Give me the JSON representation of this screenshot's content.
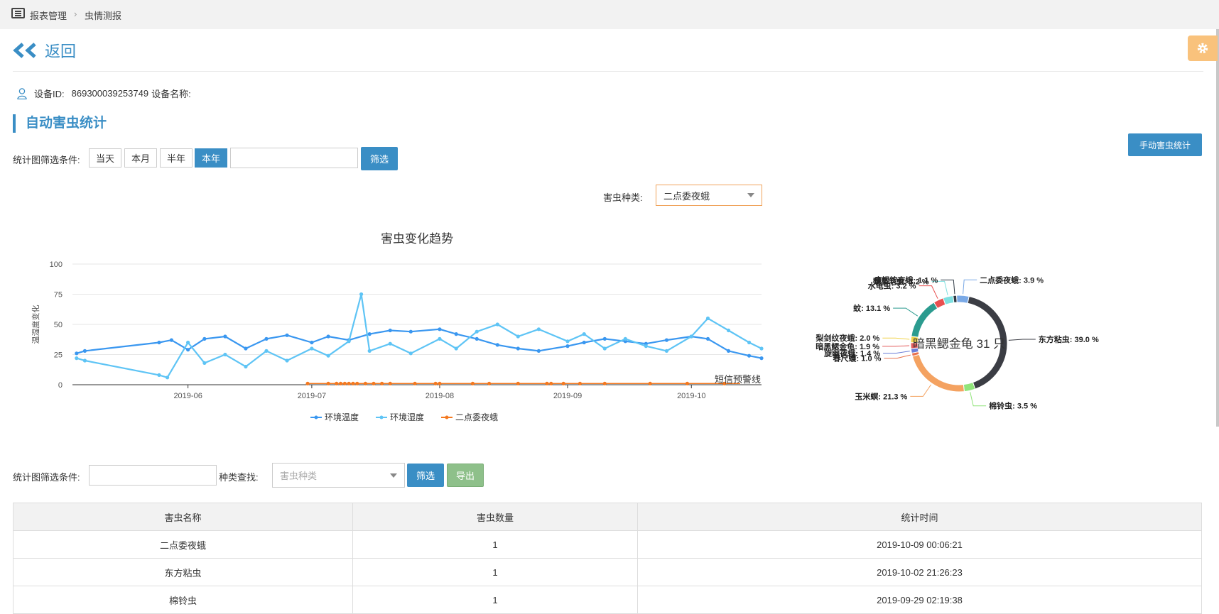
{
  "breadcrumb": {
    "parent": "报表管理",
    "separator": "›",
    "current": "虫情测报"
  },
  "header": {
    "back_label": "返回"
  },
  "device": {
    "id_label": "设备ID:",
    "id_value": "869300039253749",
    "name_label": "设备名称:"
  },
  "section": {
    "title": "自动害虫统计",
    "manual_button": "手动害虫统计"
  },
  "top_filter": {
    "label": "统计图筛选条件:",
    "ranges": [
      {
        "label": "当天",
        "active": false
      },
      {
        "label": "本月",
        "active": false
      },
      {
        "label": "半年",
        "active": false
      },
      {
        "label": "本年",
        "active": true
      }
    ],
    "date_value": "",
    "submit_label": "筛选"
  },
  "pest_type": {
    "label": "害虫种类:",
    "selected": "二点委夜蛾"
  },
  "chart_data": [
    {
      "type": "line",
      "title": "害虫变化趋势",
      "ylabel": "温湿度变化",
      "xlabel": "",
      "ylim": [
        0,
        100
      ],
      "yticks": [
        0,
        25,
        50,
        75,
        100
      ],
      "x_range": [
        "2019-05-04",
        "2019-10-18"
      ],
      "xticks": [
        "2019-06",
        "2019-07",
        "2019-08",
        "2019-09",
        "2019-10"
      ],
      "grid": true,
      "legend_position": "bottom",
      "series": [
        {
          "name": "环境温度",
          "color": "#3a97f0",
          "points": [
            [
              "2019-05-05",
              26
            ],
            [
              "2019-05-07",
              28
            ],
            [
              "2019-05-25",
              35
            ],
            [
              "2019-05-28",
              37
            ],
            [
              "2019-06-01",
              29
            ],
            [
              "2019-06-05",
              38
            ],
            [
              "2019-06-10",
              40
            ],
            [
              "2019-06-15",
              30
            ],
            [
              "2019-06-20",
              38
            ],
            [
              "2019-06-25",
              41
            ],
            [
              "2019-07-01",
              35
            ],
            [
              "2019-07-05",
              40
            ],
            [
              "2019-07-10",
              37
            ],
            [
              "2019-07-15",
              42
            ],
            [
              "2019-07-20",
              45
            ],
            [
              "2019-07-25",
              44
            ],
            [
              "2019-08-01",
              46
            ],
            [
              "2019-08-05",
              42
            ],
            [
              "2019-08-10",
              38
            ],
            [
              "2019-08-15",
              33
            ],
            [
              "2019-08-20",
              30
            ],
            [
              "2019-08-25",
              28
            ],
            [
              "2019-09-01",
              32
            ],
            [
              "2019-09-05",
              35
            ],
            [
              "2019-09-10",
              38
            ],
            [
              "2019-09-15",
              36
            ],
            [
              "2019-09-20",
              34
            ],
            [
              "2019-09-25",
              37
            ],
            [
              "2019-10-01",
              40
            ],
            [
              "2019-10-05",
              38
            ],
            [
              "2019-10-10",
              28
            ],
            [
              "2019-10-15",
              24
            ],
            [
              "2019-10-18",
              22
            ]
          ]
        },
        {
          "name": "环境湿度",
          "color": "#5ec4f5",
          "points": [
            [
              "2019-05-05",
              22
            ],
            [
              "2019-05-07",
              20
            ],
            [
              "2019-05-25",
              8
            ],
            [
              "2019-05-27",
              6
            ],
            [
              "2019-06-01",
              35
            ],
            [
              "2019-06-05",
              18
            ],
            [
              "2019-06-10",
              25
            ],
            [
              "2019-06-15",
              15
            ],
            [
              "2019-06-20",
              28
            ],
            [
              "2019-06-25",
              20
            ],
            [
              "2019-07-01",
              30
            ],
            [
              "2019-07-05",
              24
            ],
            [
              "2019-07-10",
              36
            ],
            [
              "2019-07-13",
              75
            ],
            [
              "2019-07-15",
              28
            ],
            [
              "2019-07-20",
              34
            ],
            [
              "2019-07-25",
              26
            ],
            [
              "2019-08-01",
              38
            ],
            [
              "2019-08-05",
              30
            ],
            [
              "2019-08-10",
              44
            ],
            [
              "2019-08-15",
              50
            ],
            [
              "2019-08-20",
              40
            ],
            [
              "2019-08-25",
              46
            ],
            [
              "2019-09-01",
              36
            ],
            [
              "2019-09-05",
              42
            ],
            [
              "2019-09-10",
              30
            ],
            [
              "2019-09-15",
              38
            ],
            [
              "2019-09-20",
              32
            ],
            [
              "2019-09-25",
              28
            ],
            [
              "2019-10-01",
              40
            ],
            [
              "2019-10-05",
              55
            ],
            [
              "2019-10-10",
              45
            ],
            [
              "2019-10-15",
              35
            ],
            [
              "2019-10-18",
              30
            ]
          ]
        },
        {
          "name": "二点委夜蛾",
          "color": "#f47920",
          "points": [
            [
              "2019-06-30",
              1
            ],
            [
              "2019-07-05",
              1
            ],
            [
              "2019-07-07",
              1
            ],
            [
              "2019-07-08",
              1
            ],
            [
              "2019-07-09",
              1
            ],
            [
              "2019-07-10",
              1
            ],
            [
              "2019-07-11",
              1
            ],
            [
              "2019-07-12",
              1
            ],
            [
              "2019-07-14",
              1
            ],
            [
              "2019-07-16",
              1
            ],
            [
              "2019-07-18",
              1
            ],
            [
              "2019-07-20",
              1
            ],
            [
              "2019-07-26",
              1
            ],
            [
              "2019-07-31",
              1
            ],
            [
              "2019-08-01",
              1
            ],
            [
              "2019-08-09",
              1
            ],
            [
              "2019-08-13",
              1
            ],
            [
              "2019-08-20",
              1
            ],
            [
              "2019-08-27",
              1
            ],
            [
              "2019-08-28",
              1
            ],
            [
              "2019-08-31",
              1
            ],
            [
              "2019-09-04",
              1
            ],
            [
              "2019-09-10",
              1
            ],
            [
              "2019-09-21",
              1
            ],
            [
              "2019-09-30",
              1
            ],
            [
              "2019-10-09",
              1
            ]
          ]
        }
      ],
      "markline": {
        "label": "短信预警线",
        "value": 1
      }
    },
    {
      "type": "pie",
      "center_label": "暗黑鳃金龟 31 只",
      "slices": [
        {
          "name": "东方粘虫",
          "value": 39.0,
          "label": "东方粘虫: 39.0 %",
          "color": "#3b3d44"
        },
        {
          "name": "棉铃虫",
          "value": 3.5,
          "label": "棉铃虫: 3.5 %",
          "color": "#90e47a"
        },
        {
          "name": "玉米螟",
          "value": 21.3,
          "label": "玉米螟: 21.3 %",
          "color": "#f4a261"
        },
        {
          "name": "春尺蠖",
          "value": 1.0,
          "label": "春尺蠖: 1.0 %",
          "color": "#e8724e"
        },
        {
          "name": "旋幽夜蛾",
          "value": 1.4,
          "label": "旋幽夜蛾: 1.4 %",
          "color": "#6c7fd8"
        },
        {
          "name": "暗黑鳃金龟",
          "value": 1.9,
          "label": "暗黑鳃金龟: 1.9 %",
          "color": "#e35d5d"
        },
        {
          "name": "梨剑纹夜蛾",
          "value": 2.0,
          "label": "梨剑纹夜蛾: 2.0 %",
          "color": "#f1d44c"
        },
        {
          "name": "蚊",
          "value": 13.1,
          "label": "蚊: 13.1 %",
          "color": "#2b9b8f"
        },
        {
          "name": "水龟虫",
          "value": 3.2,
          "label": "水龟虫: 3.2 %",
          "color": "#e84f4f"
        },
        {
          "name": "梨星毛虫",
          "value": 3.2,
          "label": "梨星毛虫: 3.2 %",
          "color": "#7fe0e0"
        },
        {
          "name": "瘦银锭夜蛾",
          "value": 1.1,
          "label": "瘦银锭夜蛾: 1.1 %",
          "color": "#2f3a45"
        },
        {
          "name": "二点委夜蛾",
          "value": 3.9,
          "label": "二点委夜蛾: 3.9 %",
          "color": "#7aa9e6"
        }
      ]
    }
  ],
  "bottom_filter": {
    "label": "统计图筛选条件:",
    "date_value": "",
    "type_label": "种类查找:",
    "type_placeholder": "害虫种类",
    "submit_label": "筛选",
    "export_label": "导出"
  },
  "table": {
    "headers": [
      "害虫名称",
      "害虫数量",
      "统计时间"
    ],
    "rows": [
      [
        "二点委夜蛾",
        "1",
        "2019-10-09 00:06:21"
      ],
      [
        "东方粘虫",
        "1",
        "2019-10-02 21:26:23"
      ],
      [
        "棉铃虫",
        "1",
        "2019-09-29 02:19:38"
      ]
    ]
  }
}
